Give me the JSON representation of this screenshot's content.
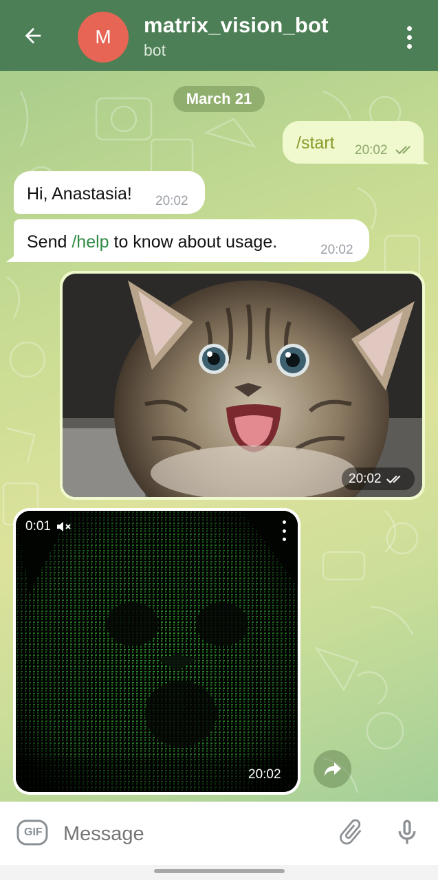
{
  "header": {
    "avatar_letter": "M",
    "title": "matrix_vision_bot",
    "subtitle": "bot",
    "back_icon": "arrow-left-icon",
    "menu_icon": "more-vertical-icon",
    "background": "#4c7f55",
    "avatar_color": "#e76554"
  },
  "chat": {
    "date_label": "March 21",
    "messages": [
      {
        "direction": "outgoing",
        "text": "/start",
        "time": "20:02",
        "status": "read"
      },
      {
        "direction": "incoming",
        "text": "Hi, Anastasia!",
        "time": "20:02"
      },
      {
        "direction": "incoming",
        "text_before": "Send ",
        "command": "/help",
        "text_after": " to know about usage.",
        "time": "20:02"
      },
      {
        "direction": "outgoing",
        "type": "photo",
        "subject": "kitten",
        "time": "20:02",
        "status": "read"
      },
      {
        "direction": "incoming",
        "type": "video",
        "subject": "matrix-style kitten",
        "duration": "0:01",
        "muted": true,
        "time": "20:02"
      }
    ],
    "outgoing_bubble_color": "#eff9cd",
    "command_color": "#2f8a45"
  },
  "composer": {
    "placeholder": "Message",
    "gif_label": "GIF",
    "attach_icon": "paperclip-icon",
    "mic_icon": "microphone-icon"
  }
}
